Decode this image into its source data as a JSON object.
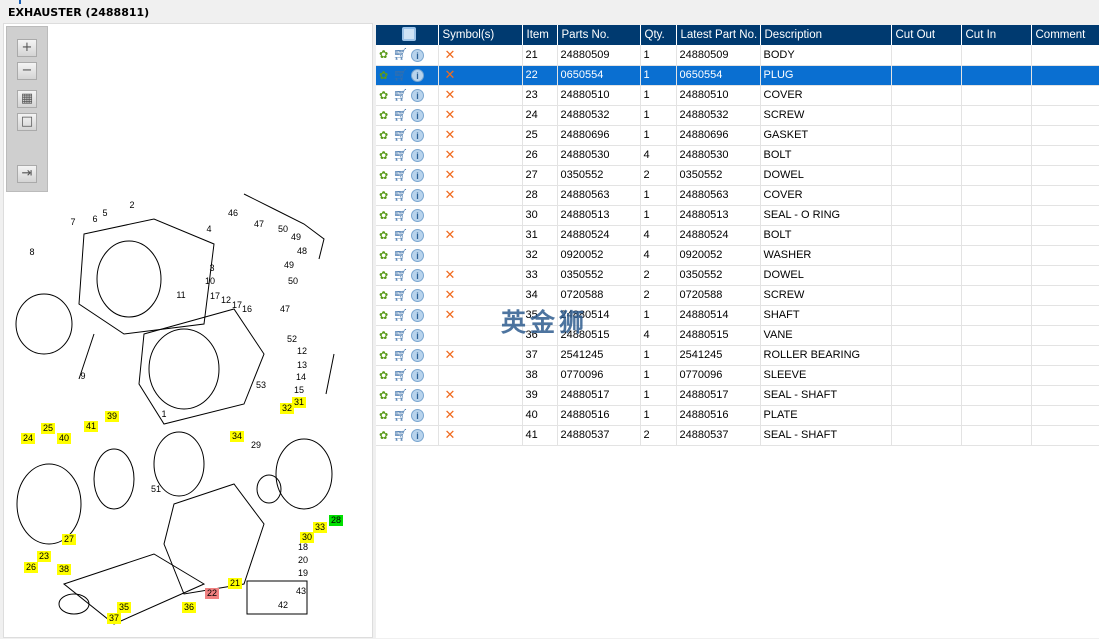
{
  "window": {
    "title": "EXHAUSTER (2488811)"
  },
  "toolbar": {
    "zoom_in": "zoom-in",
    "zoom_out": "zoom-out",
    "fit": "fit",
    "actual": "actual-size",
    "export": "export"
  },
  "table": {
    "columns": [
      "",
      "Symbol(s)",
      "Item",
      "Parts No.",
      "Qty.",
      "Latest Part No.",
      "Description",
      "Cut Out",
      "Cut In",
      "Comment"
    ],
    "rows": [
      {
        "item": "21",
        "part": "24880509",
        "qty": "1",
        "latest": "24880509",
        "desc": "BODY",
        "x": true
      },
      {
        "item": "22",
        "part": "0650554",
        "qty": "1",
        "latest": "0650554",
        "desc": "PLUG",
        "x": true,
        "selected": true
      },
      {
        "item": "23",
        "part": "24880510",
        "qty": "1",
        "latest": "24880510",
        "desc": "COVER",
        "x": true
      },
      {
        "item": "24",
        "part": "24880532",
        "qty": "1",
        "latest": "24880532",
        "desc": "SCREW",
        "x": true
      },
      {
        "item": "25",
        "part": "24880696",
        "qty": "1",
        "latest": "24880696",
        "desc": "GASKET",
        "x": true
      },
      {
        "item": "26",
        "part": "24880530",
        "qty": "4",
        "latest": "24880530",
        "desc": "BOLT",
        "x": true
      },
      {
        "item": "27",
        "part": "0350552",
        "qty": "2",
        "latest": "0350552",
        "desc": "DOWEL",
        "x": true
      },
      {
        "item": "28",
        "part": "24880563",
        "qty": "1",
        "latest": "24880563",
        "desc": "COVER",
        "x": true
      },
      {
        "item": "30",
        "part": "24880513",
        "qty": "1",
        "latest": "24880513",
        "desc": "SEAL - O RING",
        "x": false
      },
      {
        "item": "31",
        "part": "24880524",
        "qty": "4",
        "latest": "24880524",
        "desc": "BOLT",
        "x": true
      },
      {
        "item": "32",
        "part": "0920052",
        "qty": "4",
        "latest": "0920052",
        "desc": "WASHER",
        "x": false
      },
      {
        "item": "33",
        "part": "0350552",
        "qty": "2",
        "latest": "0350552",
        "desc": "DOWEL",
        "x": true
      },
      {
        "item": "34",
        "part": "0720588",
        "qty": "2",
        "latest": "0720588",
        "desc": "SCREW",
        "x": true
      },
      {
        "item": "35",
        "part": "24880514",
        "qty": "1",
        "latest": "24880514",
        "desc": "SHAFT",
        "x": true
      },
      {
        "item": "36",
        "part": "24880515",
        "qty": "4",
        "latest": "24880515",
        "desc": "VANE",
        "x": false
      },
      {
        "item": "37",
        "part": "2541245",
        "qty": "1",
        "latest": "2541245",
        "desc": "ROLLER BEARING",
        "x": true
      },
      {
        "item": "38",
        "part": "0770096",
        "qty": "1",
        "latest": "0770096",
        "desc": "SLEEVE",
        "x": false
      },
      {
        "item": "39",
        "part": "24880517",
        "qty": "1",
        "latest": "24880517",
        "desc": "SEAL - SHAFT",
        "x": true
      },
      {
        "item": "40",
        "part": "24880516",
        "qty": "1",
        "latest": "24880516",
        "desc": "PLATE",
        "x": true
      },
      {
        "item": "41",
        "part": "24880537",
        "qty": "2",
        "latest": "24880537",
        "desc": "SEAL - SHAFT",
        "x": true
      }
    ]
  },
  "diagram": {
    "callouts": [
      "2",
      "46",
      "5",
      "6",
      "7",
      "4",
      "47",
      "50",
      "49",
      "48",
      "3",
      "8",
      "49",
      "10",
      "11",
      "17",
      "12",
      "17",
      "16",
      "50",
      "47",
      "52",
      "12",
      "13",
      "14",
      "53",
      "15",
      "9",
      "1",
      "29",
      "51",
      "18",
      "20",
      "19",
      "43",
      "42",
      "31",
      "32",
      "34",
      "24",
      "25",
      "40",
      "41",
      "39",
      "33",
      "28",
      "30",
      "27",
      "23",
      "26",
      "38",
      "21",
      "22",
      "35",
      "36",
      "37"
    ],
    "highlight": {
      "31": "yellow",
      "32": "yellow",
      "34": "yellow",
      "24": "yellow",
      "25": "yellow",
      "40": "yellow",
      "41": "yellow",
      "39": "yellow",
      "33": "yellow",
      "30": "yellow",
      "27": "yellow",
      "23": "yellow",
      "26": "yellow",
      "38": "yellow",
      "21": "yellow",
      "35": "yellow",
      "36": "yellow",
      "37": "yellow",
      "22": "red",
      "28": "green"
    }
  },
  "watermark": "英金狮",
  "colors": {
    "header": "#003a70",
    "selected": "#0a6fd1",
    "yellow": "#ffff00",
    "red": "#f08080",
    "green": "#00e000"
  }
}
